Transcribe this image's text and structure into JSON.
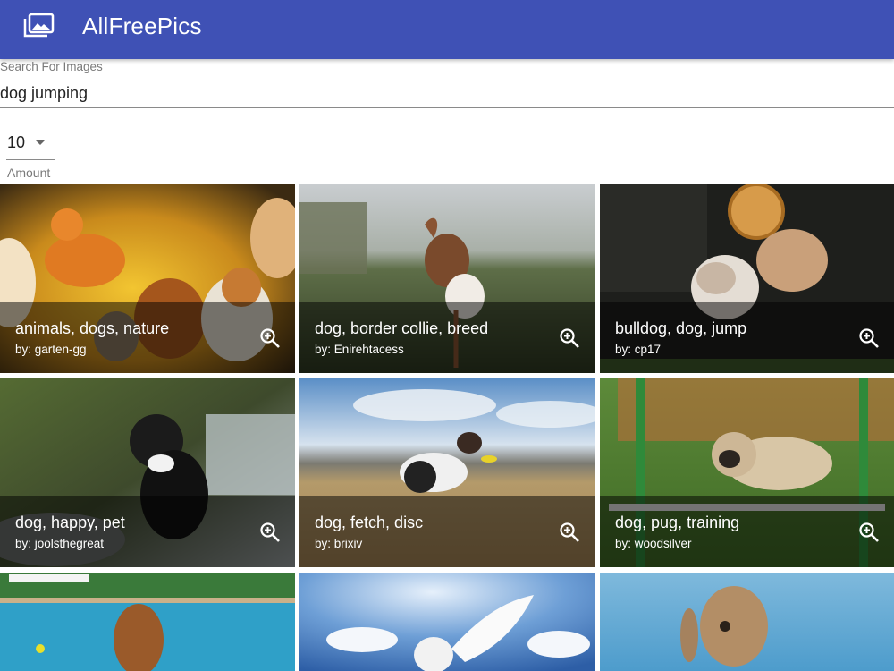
{
  "app": {
    "title": "AllFreePics",
    "logo_icon": "photo-library-icon",
    "accent": "#3f51b5"
  },
  "search": {
    "label": "Search For Images",
    "value": "dog jumping"
  },
  "amount": {
    "value": "10",
    "label": "Amount"
  },
  "results": [
    {
      "tags": "animals, dogs, nature",
      "author": "by: garten-gg"
    },
    {
      "tags": "dog, border collie, breed",
      "author": "by: Enirehtacess"
    },
    {
      "tags": "bulldog, dog, jump",
      "author": "by: cp17"
    },
    {
      "tags": "dog, happy, pet",
      "author": "by: joolsthegreat"
    },
    {
      "tags": "dog, fetch, disc",
      "author": "by: brixiv"
    },
    {
      "tags": "dog, pug, training",
      "author": "by: woodsilver"
    }
  ]
}
